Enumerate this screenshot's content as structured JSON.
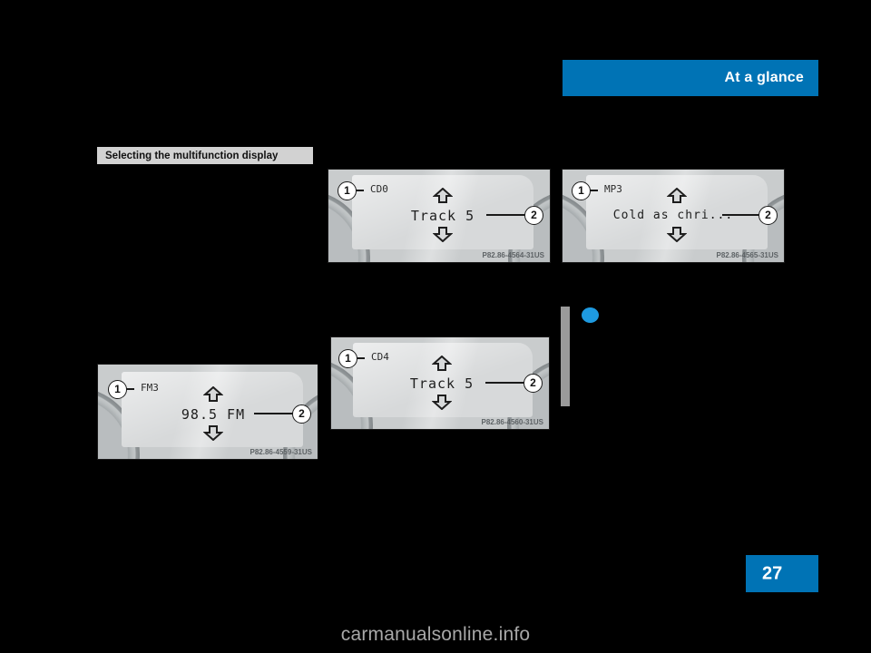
{
  "header": {
    "title": "At a glance",
    "accent_color": "#0073b5"
  },
  "section": {
    "heading": "Selecting the multifunction display",
    "band_color": "#d2d2d2"
  },
  "figures": [
    {
      "id": "cd0",
      "mode_label": "CD0",
      "main_text": "Track 5",
      "callout_left": "1",
      "callout_right": "2",
      "code": "P82.86-4564-31US"
    },
    {
      "id": "mp3",
      "mode_label": "MP3",
      "main_text": "Cold as chri...",
      "callout_left": "1",
      "callout_right": "2",
      "code": "P82.86-4565-31US"
    },
    {
      "id": "cd4",
      "mode_label": "CD4",
      "main_text": "Track 5",
      "callout_left": "1",
      "callout_right": "2",
      "code": "P82.86-4560-31US"
    },
    {
      "id": "fm3",
      "mode_label": "FM3",
      "main_text": "98.5 FM",
      "callout_left": "1",
      "callout_right": "2",
      "code": "P82.86-4559-31US"
    }
  ],
  "marker": {
    "bullet_color": "#1e9ae0",
    "rule_color": "#9a9a9a"
  },
  "page": {
    "number": "27",
    "tab_color": "#0073b5"
  },
  "footer": {
    "watermark": "carmanualsonline.info"
  }
}
